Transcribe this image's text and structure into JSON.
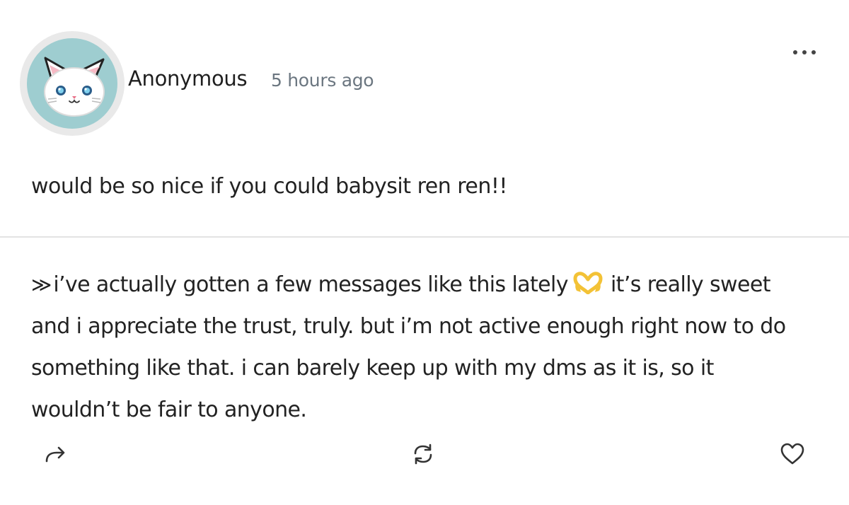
{
  "post": {
    "author": "Anonymous",
    "timestamp": "5 hours ago",
    "avatar_icon": "cat-avatar-icon",
    "menu_icon": "more-options-icon",
    "question": "would be so nice if you could babysit ren ren!!"
  },
  "answer": {
    "prefix_icon": "double-chevron-right-icon",
    "prefix_glyph": "≫",
    "text_before_emoji": "i’ve actually gotten a few messages like this lately",
    "emoji_icon": "heart-hands-emoji",
    "text_line1_after": "it’s really sweet",
    "text_line2": "and i appreciate the trust, truly. but i’m not active enough right now to do",
    "text_line3": "something like that. i can barely keep up with my dms as it is, so it",
    "text_line4": "wouldn’t be fair to anyone."
  },
  "actions": {
    "share_icon": "share-arrow-icon",
    "repost_icon": "repost-icon",
    "like_icon": "heart-icon"
  },
  "colors": {
    "text": "#222222",
    "timestamp": "#6b7680",
    "divider": "#e3e3e3",
    "avatar_bg": "#9ecdd0",
    "emoji": "#f3c236"
  }
}
